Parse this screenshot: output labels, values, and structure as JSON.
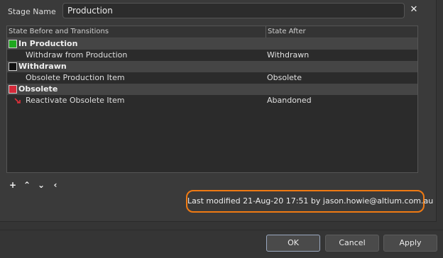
{
  "stage": {
    "label": "Stage Name",
    "value": "Production"
  },
  "grid": {
    "headers": {
      "left": "State Before and Transitions",
      "right": "State After"
    },
    "rows": [
      {
        "kind": "group",
        "label": "In Production",
        "color": "#1fa81f",
        "after": ""
      },
      {
        "kind": "trans",
        "label": "Withdraw from Production",
        "after": "Withdrawn"
      },
      {
        "kind": "group",
        "label": "Withdrawn",
        "color": "#111111",
        "after": ""
      },
      {
        "kind": "trans",
        "label": "Obsolete Production Item",
        "after": "Obsolete"
      },
      {
        "kind": "group",
        "label": "Obsolete",
        "color": "#d42a3a",
        "after": ""
      },
      {
        "kind": "trans",
        "label": "Reactivate Obsolete Item",
        "after": "Abandoned",
        "icon": "reactivate-icon"
      }
    ]
  },
  "toolbar": {
    "add": "+",
    "up": "⌃",
    "down": "⌄",
    "left": "‹"
  },
  "footer": {
    "last_modified": "Last modified 21-Aug-20 17:51 by jason.howie@altium.com.au"
  },
  "buttons": {
    "ok": "OK",
    "cancel": "Cancel",
    "apply": "Apply"
  },
  "colors": {
    "highlight": "#f07a12"
  }
}
